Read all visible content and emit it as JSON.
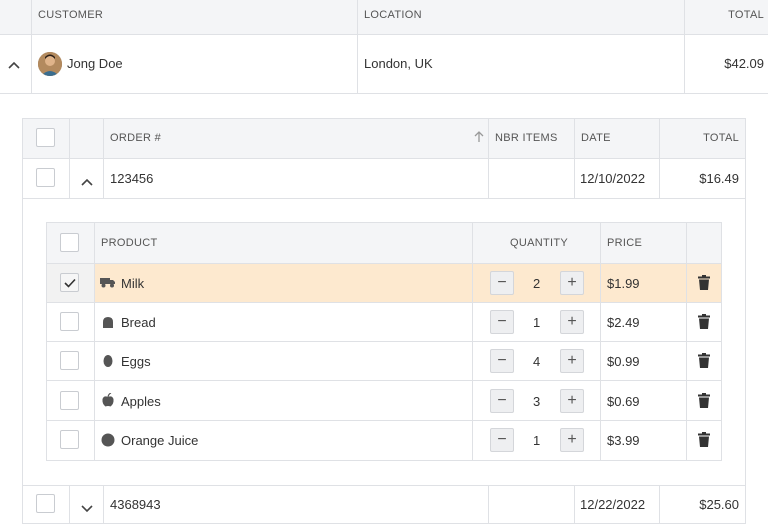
{
  "customers_table": {
    "headers": {
      "customer": "CUSTOMER",
      "location": "LOCATION",
      "total": "TOTAL"
    },
    "row": {
      "name": "Jong Doe",
      "location": "London, UK",
      "total": "$42.09"
    }
  },
  "orders_table": {
    "headers": {
      "order": "ORDER #",
      "nbr_items": "NBR ITEMS",
      "date": "DATE",
      "total": "TOTAL"
    },
    "rows": [
      {
        "order": "123456",
        "nbr_items": "",
        "date": "12/10/2022",
        "total": "$16.49"
      },
      {
        "order": "4368943",
        "nbr_items": "",
        "date": "12/22/2022",
        "total": "$25.60"
      }
    ]
  },
  "products_table": {
    "headers": {
      "product": "PRODUCT",
      "quantity": "QUANTITY",
      "price": "PRICE"
    },
    "minus": "−",
    "plus": "+",
    "rows": [
      {
        "product": "Milk",
        "icon": "truck-icon",
        "quantity": "2",
        "price": "$1.99",
        "checked": true
      },
      {
        "product": "Bread",
        "icon": "bread-icon",
        "quantity": "1",
        "price": "$2.49",
        "checked": false
      },
      {
        "product": "Eggs",
        "icon": "egg-icon",
        "quantity": "4",
        "price": "$0.99",
        "checked": false
      },
      {
        "product": "Apples",
        "icon": "apple-icon",
        "quantity": "3",
        "price": "$0.69",
        "checked": false
      },
      {
        "product": "Orange Juice",
        "icon": "circle-icon",
        "quantity": "1",
        "price": "$3.99",
        "checked": false
      }
    ]
  },
  "colors": {
    "selected_row": "#fde9cf",
    "header": "#f4f5f7",
    "border": "#dfe1e5"
  }
}
